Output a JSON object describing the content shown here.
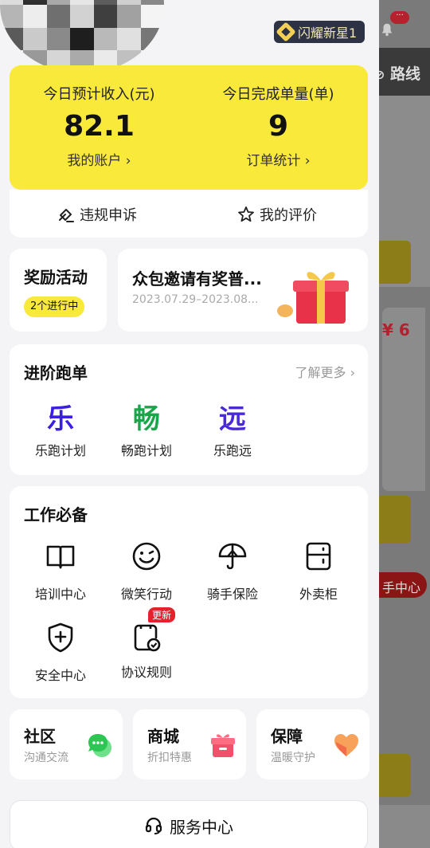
{
  "background": {
    "route_label": "路线",
    "price_label": "¥ 6",
    "help_label": "手中心",
    "notification_dot": "···"
  },
  "header": {
    "level_badge": "闪耀新星1"
  },
  "stats": {
    "income_label": "今日预计收入(元)",
    "income_value": "82.1",
    "account_link": "我的账户 ›",
    "orders_label": "今日完成单量(单)",
    "orders_value": "9",
    "orders_link": "订单统计 ›",
    "complaint_label": "违规申诉",
    "rating_label": "我的评价"
  },
  "reward": {
    "title": "奖励活动",
    "pill": "2个进行中"
  },
  "invite": {
    "title": "众包邀请有奖普...",
    "date": "2023.07.29–2023.08..."
  },
  "advanced": {
    "title": "进阶跑单",
    "more": "了解更多 ›",
    "plans": [
      {
        "glyph": "乐",
        "label": "乐跑计划",
        "color": "#3b1fe0"
      },
      {
        "glyph": "畅",
        "label": "畅跑计划",
        "color": "#1aa54a"
      },
      {
        "glyph": "远",
        "label": "乐跑远",
        "color": "#4a2ad8"
      }
    ]
  },
  "work": {
    "title": "工作必备",
    "tools": [
      {
        "label": "培训中心",
        "icon": "book-icon"
      },
      {
        "label": "微笑行动",
        "icon": "smile-icon"
      },
      {
        "label": "骑手保险",
        "icon": "umbrella-icon"
      },
      {
        "label": "外卖柜",
        "icon": "locker-icon"
      },
      {
        "label": "安全中心",
        "icon": "shield-icon"
      },
      {
        "label": "协议规则",
        "icon": "agreement-icon",
        "tag": "更新"
      }
    ]
  },
  "minis": [
    {
      "title": "社区",
      "desc": "沟通交流",
      "icon": "chat-bubble-icon"
    },
    {
      "title": "商城",
      "desc": "折扣特惠",
      "icon": "gift-box-icon"
    },
    {
      "title": "保障",
      "desc": "温暖守护",
      "icon": "heart-icon"
    }
  ],
  "service": {
    "label": "服务中心"
  },
  "colors": {
    "accent_yellow": "#f9e93b",
    "badge_dark": "#2d3244",
    "tag_red": "#e5212c"
  }
}
